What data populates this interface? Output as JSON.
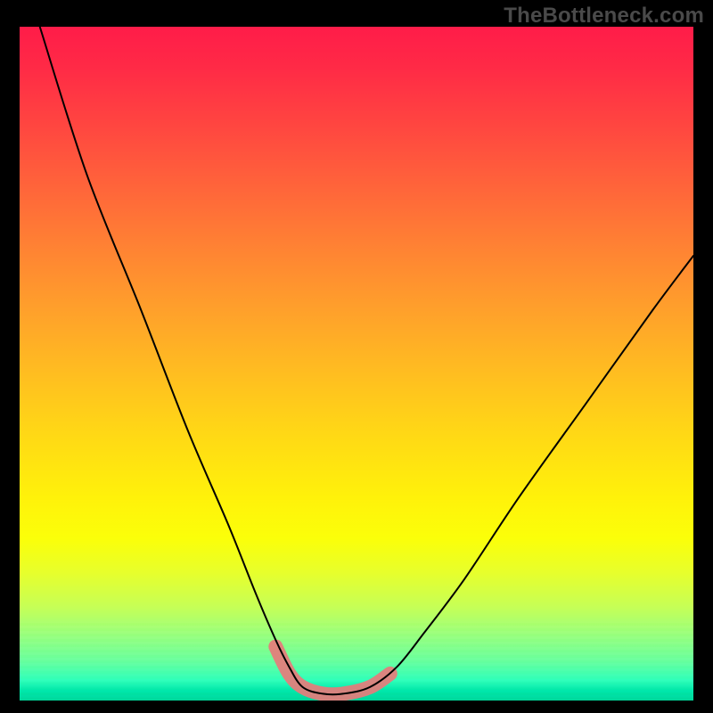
{
  "watermark": "TheBottleneck.com",
  "chart_data": {
    "type": "line",
    "title": "",
    "xlabel": "",
    "ylabel": "",
    "xlim": [
      0,
      100
    ],
    "ylim": [
      0,
      100
    ],
    "grid": false,
    "series": [
      {
        "name": "curve",
        "x": [
          3,
          10,
          18,
          25,
          31,
          35,
          38,
          40,
          42,
          45,
          48,
          52,
          56,
          60,
          66,
          74,
          84,
          94,
          100
        ],
        "values": [
          100,
          78,
          58,
          40,
          26,
          16,
          9,
          5,
          2,
          1,
          1,
          2,
          5,
          10,
          18,
          30,
          44,
          58,
          66
        ]
      }
    ],
    "accent": {
      "name": "bottom-segment",
      "color": "#e77b7b",
      "x": [
        38,
        40,
        42,
        45,
        48,
        52,
        55
      ],
      "values": [
        8,
        4,
        2,
        1,
        1,
        2,
        4
      ]
    },
    "background_gradient": {
      "top": "#ff1c49",
      "mid": "#fff20a",
      "bottom": "#00d79c"
    }
  }
}
